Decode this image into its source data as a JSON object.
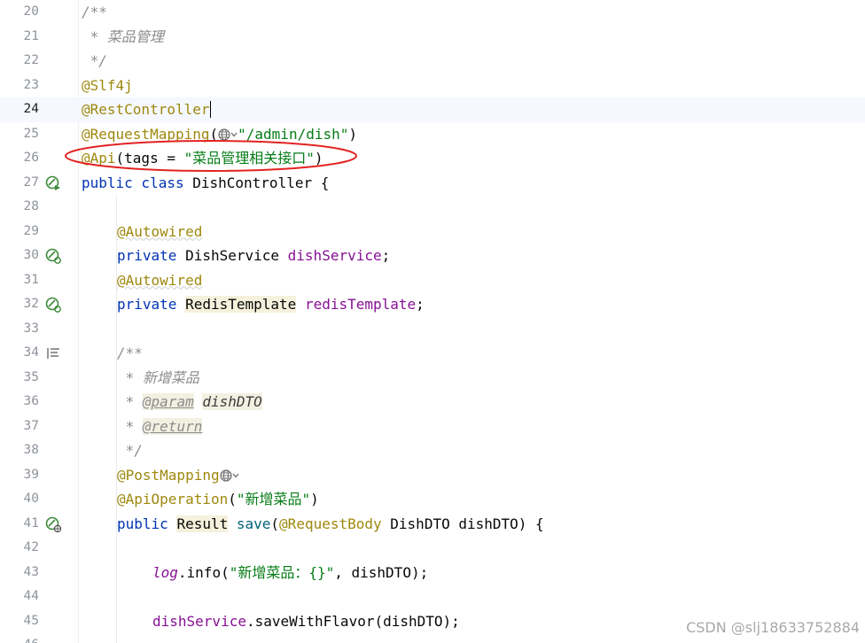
{
  "editor": {
    "lines": [
      {
        "num": "20",
        "tokens": [
          {
            "t": "/**",
            "c": "doc"
          }
        ]
      },
      {
        "num": "21",
        "tokens": [
          {
            "t": " * 菜品管理",
            "c": "doc"
          }
        ]
      },
      {
        "num": "22",
        "tokens": [
          {
            "t": " */",
            "c": "doc"
          }
        ]
      },
      {
        "num": "23",
        "tokens": [
          {
            "t": "@Slf4j",
            "c": "ann"
          }
        ]
      },
      {
        "num": "24",
        "current": true,
        "tokens": [
          {
            "t": "@RestController",
            "c": "ann"
          }
        ]
      },
      {
        "num": "25",
        "tokens": [
          {
            "t": "@RequestMapping",
            "c": "ann"
          },
          {
            "t": "(",
            "c": ""
          },
          {
            "t": "",
            "c": "globe"
          },
          {
            "t": "\"/admin/dish\"",
            "c": "str"
          },
          {
            "t": ")",
            "c": ""
          }
        ]
      },
      {
        "num": "26",
        "tokens": [
          {
            "t": "@Api",
            "c": "ann"
          },
          {
            "t": "(tags = ",
            "c": ""
          },
          {
            "t": "\"菜品管理相关接口\"",
            "c": "str"
          },
          {
            "t": ")",
            "c": ""
          }
        ]
      },
      {
        "num": "27",
        "icon": "bean-run",
        "tokens": [
          {
            "t": "public class ",
            "c": "kw"
          },
          {
            "t": "DishController {",
            "c": ""
          }
        ]
      },
      {
        "num": "28",
        "tokens": []
      },
      {
        "num": "29",
        "indent": 1,
        "tokens": [
          {
            "t": "@Autowired",
            "c": "ann wavy"
          }
        ]
      },
      {
        "num": "30",
        "icon": "bean-inject",
        "indent": 1,
        "tokens": [
          {
            "t": "private ",
            "c": "kw"
          },
          {
            "t": "DishService ",
            "c": ""
          },
          {
            "t": "dishService",
            "c": "field"
          },
          {
            "t": ";",
            "c": ""
          }
        ]
      },
      {
        "num": "31",
        "indent": 1,
        "tokens": [
          {
            "t": "@Autowired",
            "c": "ann wavy"
          }
        ]
      },
      {
        "num": "32",
        "icon": "bean-inject",
        "indent": 1,
        "tokens": [
          {
            "t": "private ",
            "c": "kw"
          },
          {
            "t": "RedisTemplate",
            "c": "cls-hl"
          },
          {
            "t": " ",
            "c": ""
          },
          {
            "t": "redisTemplate",
            "c": "field"
          },
          {
            "t": ";",
            "c": ""
          }
        ]
      },
      {
        "num": "33",
        "tokens": []
      },
      {
        "num": "34",
        "icon": "doc-lines",
        "indent": 1,
        "tokens": [
          {
            "t": "/**",
            "c": "doc"
          }
        ]
      },
      {
        "num": "35",
        "indent": 1,
        "tokens": [
          {
            "t": " * 新增菜品",
            "c": "doc"
          }
        ]
      },
      {
        "num": "36",
        "indent": 1,
        "tokens": [
          {
            "t": " * ",
            "c": "doc"
          },
          {
            "t": "@param",
            "c": "tag tagbg"
          },
          {
            "t": " ",
            "c": ""
          },
          {
            "t": "dishDTO",
            "c": "docarg tagbg"
          }
        ]
      },
      {
        "num": "37",
        "indent": 1,
        "tokens": [
          {
            "t": " * ",
            "c": "doc"
          },
          {
            "t": "@return",
            "c": "tag tagbg"
          }
        ]
      },
      {
        "num": "38",
        "indent": 1,
        "tokens": [
          {
            "t": " */",
            "c": "doc"
          }
        ]
      },
      {
        "num": "39",
        "indent": 1,
        "tokens": [
          {
            "t": "@PostMapping",
            "c": "ann"
          },
          {
            "t": "",
            "c": "globe"
          }
        ]
      },
      {
        "num": "40",
        "indent": 1,
        "tokens": [
          {
            "t": "@ApiOperation",
            "c": "ann"
          },
          {
            "t": "(",
            "c": ""
          },
          {
            "t": "\"新增菜品\"",
            "c": "str"
          },
          {
            "t": ")",
            "c": ""
          }
        ]
      },
      {
        "num": "41",
        "icon": "bean-web",
        "indent": 1,
        "tokens": [
          {
            "t": "public ",
            "c": "kw"
          },
          {
            "t": "Result",
            "c": "cls-hl"
          },
          {
            "t": " ",
            "c": ""
          },
          {
            "t": "save",
            "c": "method"
          },
          {
            "t": "(",
            "c": ""
          },
          {
            "t": "@RequestBody ",
            "c": "ann"
          },
          {
            "t": "DishDTO dishDTO) {",
            "c": ""
          }
        ]
      },
      {
        "num": "42",
        "tokens": []
      },
      {
        "num": "43",
        "indent": 2,
        "tokens": [
          {
            "t": "log",
            "c": "static"
          },
          {
            "t": ".info(",
            "c": ""
          },
          {
            "t": "\"新增菜品：{}\"",
            "c": "str"
          },
          {
            "t": ", dishDTO);",
            "c": ""
          }
        ]
      },
      {
        "num": "44",
        "tokens": []
      },
      {
        "num": "45",
        "indent": 2,
        "tokens": [
          {
            "t": "dishService",
            "c": "field"
          },
          {
            "t": ".saveWithFlavor(dishDTO);",
            "c": ""
          }
        ]
      },
      {
        "num": "46",
        "tokens": []
      }
    ]
  },
  "watermark": "CSDN @slj18633752884",
  "colors": {
    "annotation": "#9e880d",
    "keyword": "#0033b3",
    "string": "#067d17",
    "comment": "#8c8c8c",
    "field": "#871094",
    "method": "#00627a",
    "ellipse": "#e32222",
    "bean_icon": "#3d8b3a"
  },
  "highlight": {
    "target_line": "26",
    "shape": "ellipse"
  }
}
